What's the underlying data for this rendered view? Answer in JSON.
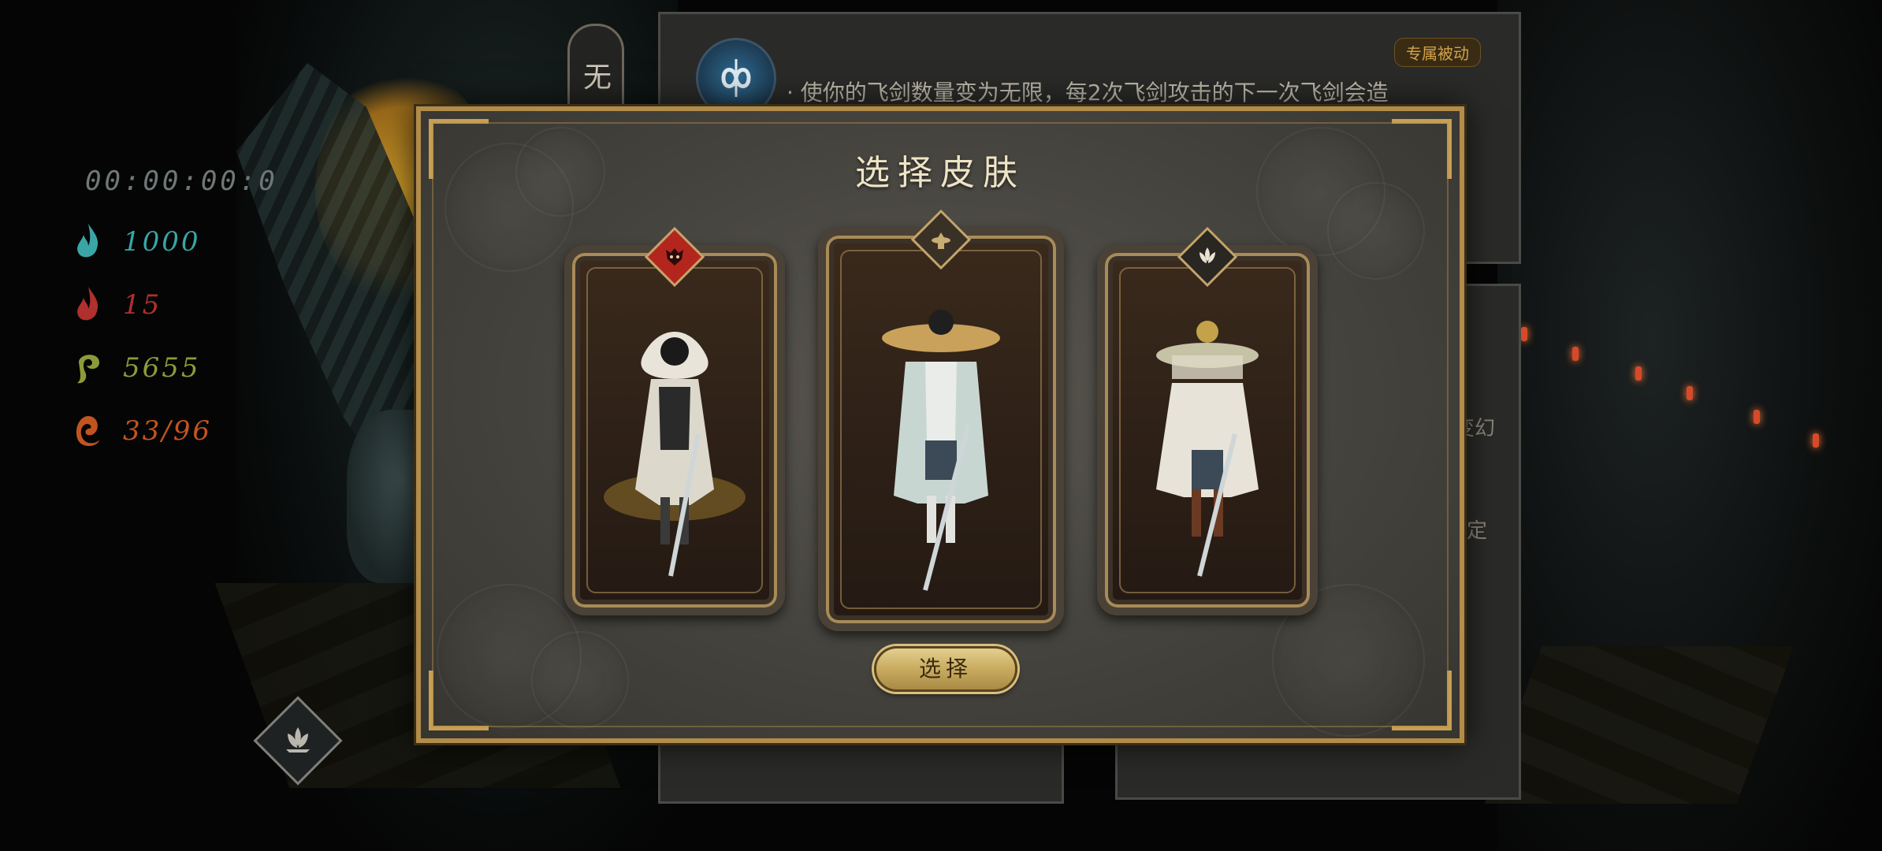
{
  "hud": {
    "timer": "00:00:00:0",
    "stats": [
      {
        "icon": "blue-flame-icon",
        "value": "1000",
        "color": "#3aa5a6"
      },
      {
        "icon": "red-flame-icon",
        "value": "15",
        "color": "#b0302d"
      },
      {
        "icon": "green-spirit-icon",
        "value": "5655",
        "color": "#8e9a3a"
      },
      {
        "icon": "orange-swirl-icon",
        "value": "33/96",
        "color": "#c2551f"
      }
    ]
  },
  "background": {
    "vertical_tab": "无",
    "skill_badge": "专属被动",
    "skill_description": "· 使你的飞剑数量变为无限，每2次飞剑攻击的下一次飞剑会造",
    "side_text_1": "变幻",
    "side_text_2": "定"
  },
  "modal": {
    "title": "选择皮肤",
    "select_button": "选择",
    "skins": [
      {
        "badge_icon": "demon-mask-icon",
        "badge_color": "#b3261e"
      },
      {
        "badge_icon": "straw-hat-icon",
        "badge_color": "#3a3126"
      },
      {
        "badge_icon": "lotus-icon",
        "badge_color": "#2a2622"
      }
    ]
  },
  "colors": {
    "gold_border": "#b18c4a",
    "panel_bg": "#4a4842",
    "title_text": "#efe4c6"
  }
}
